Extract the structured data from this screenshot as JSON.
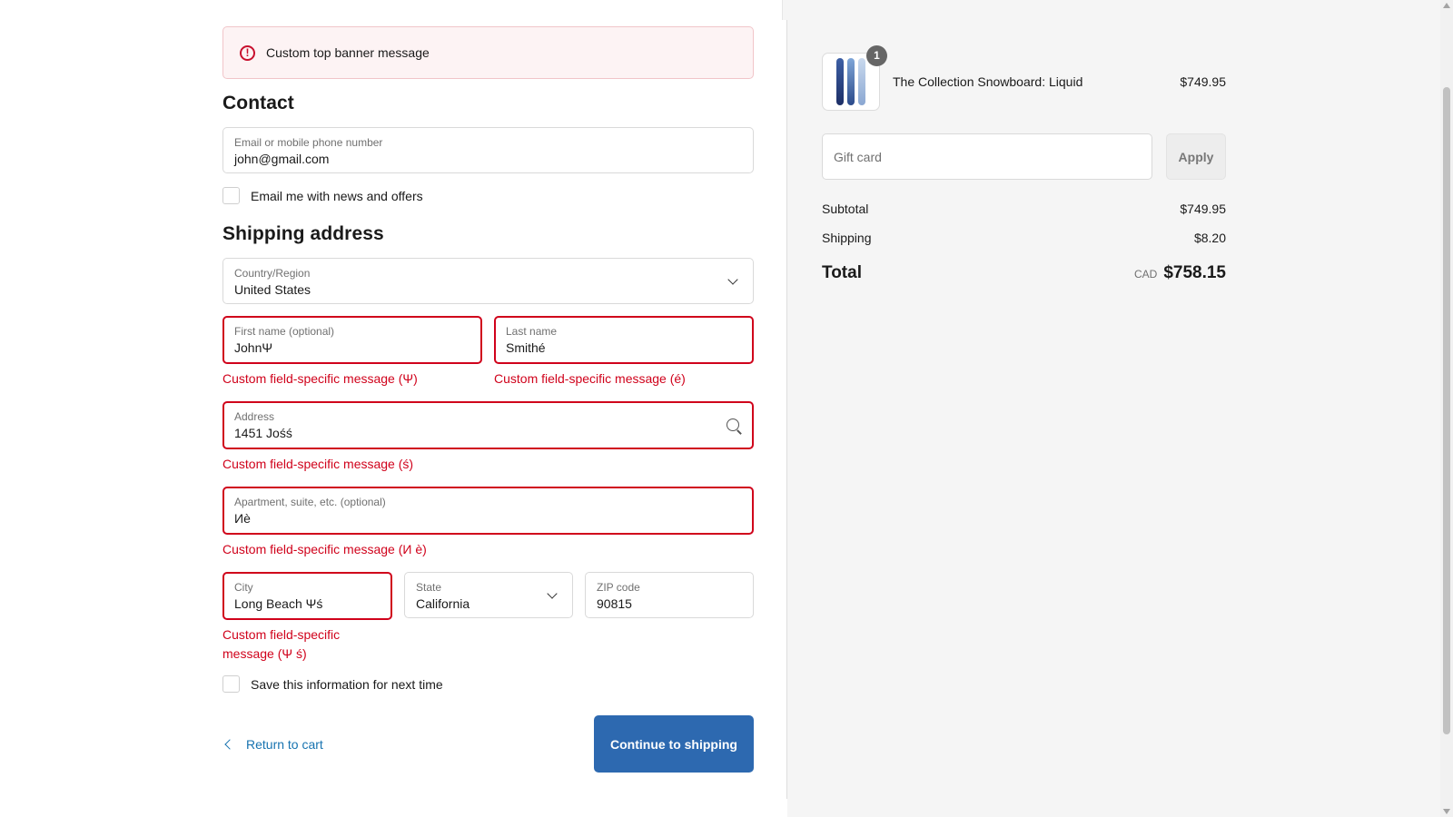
{
  "banner": {
    "message": "Custom top banner message",
    "icon": "alert-circle-icon"
  },
  "contact": {
    "heading": "Contact",
    "email_label": "Email or mobile phone number",
    "email_value": "john@gmail.com",
    "news_checkbox_label": "Email me with news and offers"
  },
  "shipping": {
    "heading": "Shipping address",
    "country_label": "Country/Region",
    "country_value": "United States",
    "first_name_label": "First name (optional)",
    "first_name_value": "JohnΨ",
    "first_name_error": "Custom field-specific message (Ψ)",
    "last_name_label": "Last name",
    "last_name_value": "Smithé",
    "last_name_error": "Custom field-specific message (é)",
    "address_label": "Address",
    "address_value": "1451 Jośś",
    "address_error": "Custom field-specific message (ś)",
    "apartment_label": "Apartment, suite, etc. (optional)",
    "apartment_value": "Иè",
    "apartment_error": "Custom field-specific message (И è)",
    "city_label": "City",
    "city_value": "Long Beach Ψś",
    "city_error_line1": "Custom field-specific",
    "city_error_line2": "message (Ψ ś)",
    "state_label": "State",
    "state_value": "California",
    "zip_label": "ZIP code",
    "zip_value": "90815",
    "save_checkbox_label": "Save this information for next time"
  },
  "actions": {
    "return_label": "Return to cart",
    "continue_label": "Continue to shipping"
  },
  "summary": {
    "item_name": "The Collection Snowboard: Liquid",
    "item_price": "$749.95",
    "item_quantity": "1",
    "gift_card_placeholder": "Gift card",
    "apply_label": "Apply",
    "subtotal_label": "Subtotal",
    "subtotal_value": "$749.95",
    "shipping_label": "Shipping",
    "shipping_value": "$8.20",
    "total_label": "Total",
    "total_currency": "CAD",
    "total_value": "$758.15"
  },
  "colors": {
    "accent": "#2d69b0",
    "error": "#d0021b",
    "link": "#1773b0",
    "summary_bg": "#f5f5f5"
  }
}
